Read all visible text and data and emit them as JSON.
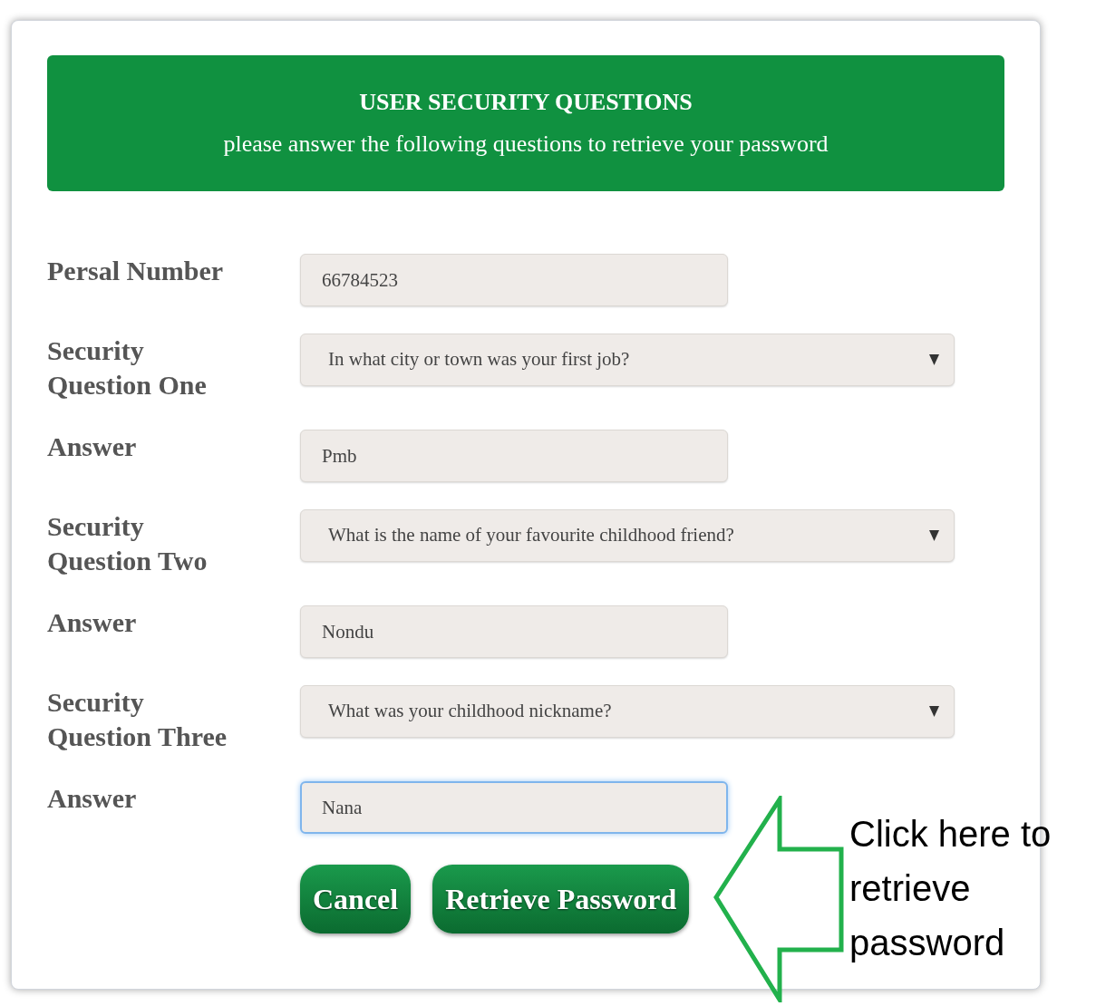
{
  "header": {
    "title": "USER SECURITY QUESTIONS",
    "subtitle": "please answer the following questions to retrieve your password"
  },
  "fields": [
    {
      "kind": "text",
      "label": "Persal Number",
      "value": "66784523",
      "focused": false
    },
    {
      "kind": "select",
      "label": "Security Question One",
      "value": "In what city or town was your first job?"
    },
    {
      "kind": "text",
      "label": "Answer",
      "value": "Pmb",
      "focused": false
    },
    {
      "kind": "select",
      "label": "Security Question Two",
      "value": "What is the name of your favourite childhood friend?"
    },
    {
      "kind": "text",
      "label": "Answer",
      "value": "Nondu",
      "focused": false
    },
    {
      "kind": "select",
      "label": "Security Question Three",
      "value": "What was your childhood nickname?"
    },
    {
      "kind": "text",
      "label": "Answer",
      "value": "Nana",
      "focused": true
    }
  ],
  "buttons": [
    "Cancel",
    "Retrieve Password"
  ],
  "callout": {
    "text": "Click here to retrieve password"
  }
}
